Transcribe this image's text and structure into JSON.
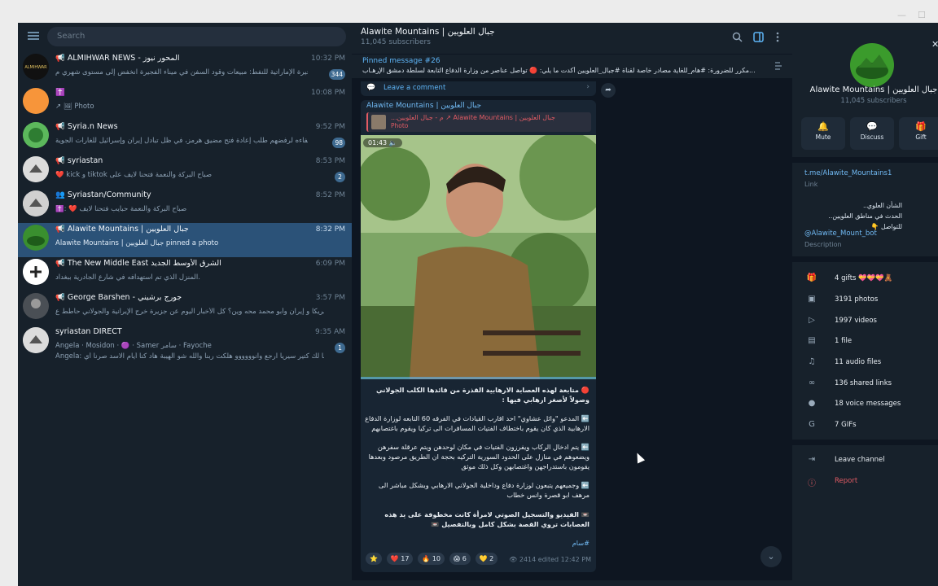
{
  "search": {
    "placeholder": "Search"
  },
  "chats": [
    {
      "name": "📢 ALMIHWAR NEWS - المحور نيوز",
      "time": "10:32 PM",
      "preview": "منظمة الفجيرة الإماراتية للنفط: مبيعات وقود السفن في ميناء الفجيرة انخفض إلى مستوى شهري م...",
      "badge": "344"
    },
    {
      "name": "✝️",
      "time": "10:08 PM",
      "preview": "↗ 🖼 Photo",
      "badge": ""
    },
    {
      "name": "📢 Syria.n News",
      "time": "9:52 PM",
      "preview": "انتقد ترامب حلفاءه لرفضهم طلب إعادة فتح مضيق هرمز، في ظل تبادل إيران وإسرائيل للغارات الجوية",
      "badge": "98"
    },
    {
      "name": "📢 syriastan",
      "time": "8:53 PM",
      "preview": "❤️ kick و tiktok صباح البركة والنعمة فتحنا لايف على",
      "badge": "2"
    },
    {
      "name": "👥 Syriastan/Community",
      "time": "8:52 PM",
      "preview": "✝️: ❤️ صباح البركة والنعمة حبايب فتحنا لايف",
      "badge": ""
    },
    {
      "name": "📢 Alawite Mountains | جبال العلويين",
      "time": "8:32 PM",
      "preview": "Alawite Mountains | جبال العلويين pinned a photo",
      "badge": ""
    },
    {
      "name": "📢 The New Middle East الشرق الأوسط الجديد",
      "time": "6:09 PM",
      "preview": "المنزل الذي تم استهدافه في شارع الجادرية ببغداد.",
      "badge": ""
    },
    {
      "name": "📢 George Barshen - جورج برشيني",
      "time": "3:57 PM",
      "preview": "العالم يحرب أمريكا و إيران وأبو محمد محه وين؟ كل الأخبار اليوم عن جزيرة خرج الإيرانية والجولاني حاطط ع",
      "badge": ""
    },
    {
      "name": "syriastan DIRECT",
      "time": "9:35 AM",
      "preview": "Angela · Mosidon · 🟣 · Samer سامر · Fayoche",
      "preview2": "Angela: اشتقنا لك كتير سيريا ارجع وانوووووو هلكت ربنا والله شو الهيبة هاد كنا أيام الاسد صرنا أي",
      "badge": "1"
    }
  ],
  "channel": {
    "title": "Alawite Mountains | جبال العلويين",
    "subscribers": "11,045 subscribers",
    "pinned_label": "Pinned message #26",
    "pinned_text": "مكرر للضرورة: #هام_للغاية   مصادر خاصة لقناة #جبال_العلويين أكدت ما يلي: 🔴 تواصل عناصر من وزارة الدفاع التابعة لسلطة دمشق الإرهـاب...",
    "leave_comment": "Leave a comment"
  },
  "message": {
    "author": "Alawite Mountains | جبال العلويين",
    "forward_from": "...م - جبال العلويين ↗ Alawite Mountains | جبال العلويين",
    "forward_type": "Photo",
    "duration": "01:43 🔈",
    "paragraphs": [
      "🔴 متابعة لهذه العصابة الارهابية القذرة من قائدها الكلب الجولاني وصولاً لأصغر ارهابي فيها :",
      "⬅️ المدعو \"وائل عشاوي\" احد اقارب القيادات في الفرقه 60 التابعه لوزارة الدفاع الارهابية الذي كان يقوم باختطاف الفتيات المسافرات الى تركيا ويقوم باغتصابهم",
      "⬅️ يتم ادخال الركاب ويفرزون الفتيات في مكان لوحدهن ويتم عرقلة سفرهن ويضعوهم في منازل على الحدود السورية التركيه بحجة ان الطريق مرصود وبعدها يقومون باستدراجهن واغتصابهن وكل ذلك موثق",
      "⬅️ وجميعهم يتبعون لوزارة دفاع وداخلية الجولاني الارهابي وبشكل مباشر الى مرهف ابو قصرة وانس خطاب",
      "📼 الفيديو والتسجيل الصوتي لامرأة كانت مخطوفة على يد هذه العصابات تروي القصة بشكل كامل وبالتفصيل 📼",
      "#سام"
    ],
    "reactions": [
      "⭐",
      "❤️ 17",
      "🔥 10",
      "😱 6",
      "💛 2"
    ],
    "views": "👁 2414  edited 12:42 PM"
  },
  "profile": {
    "name": "Alawite Mountains | جبال العلويين",
    "subscribers": "11,045 subscribers",
    "actions": [
      {
        "icon": "🔔",
        "label": "Mute"
      },
      {
        "icon": "💬",
        "label": "Discuss"
      },
      {
        "icon": "🎁",
        "label": "Gift"
      }
    ],
    "link": "t.me/Alawite_Mountains1",
    "link_label": "Link",
    "description_lines": [
      "الشأن العلوي..",
      "الحدث في مناطق العلويين..",
      "للتواصل 👇"
    ],
    "bot": "@Alawite_Mount_bot",
    "description_label": "Description",
    "stats": [
      {
        "icon": "🎁",
        "text": "4 gifts 💝💝💝🧸"
      },
      {
        "icon": "▣",
        "text": "3191 photos"
      },
      {
        "icon": "▷",
        "text": "1997 videos"
      },
      {
        "icon": "▤",
        "text": "1 file"
      },
      {
        "icon": "♫",
        "text": "11 audio files"
      },
      {
        "icon": "∞",
        "text": "136 shared links"
      },
      {
        "icon": "●",
        "text": "18 voice messages"
      },
      {
        "icon": "G",
        "text": "7 GIFs"
      }
    ],
    "leave": "Leave channel",
    "report": "Report"
  },
  "colors": {
    "accent": "#5eb5f7",
    "active_chat": "#2b5278",
    "danger": "#e15b64"
  }
}
